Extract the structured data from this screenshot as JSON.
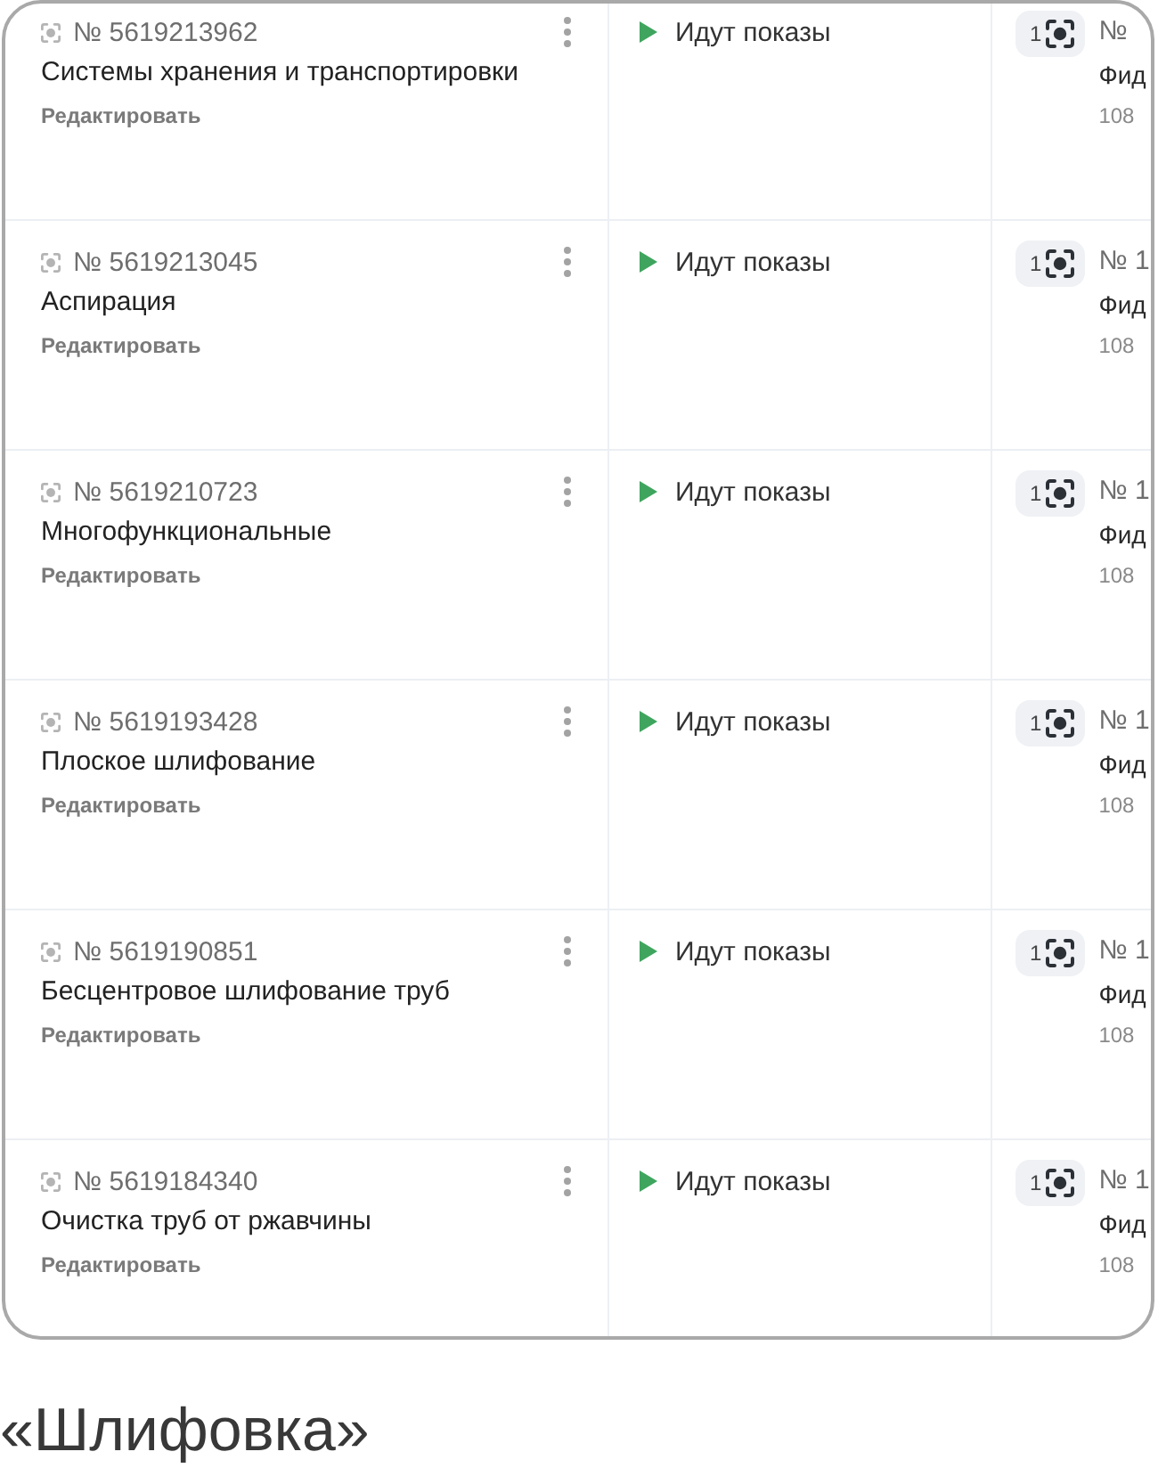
{
  "rows": [
    {
      "number": "№ 5619213962",
      "name": "Системы хранения и транспортировки",
      "edit_link": "Редактировать",
      "status": {
        "kind": "running",
        "label": "Идут показы"
      },
      "column_3": {
        "badge_count": "1",
        "line_1": "№",
        "line_2": "Фид",
        "line_3": "108"
      }
    },
    {
      "number": "№ 5619213045",
      "name": "Аспирация",
      "edit_link": "Редактировать",
      "status": {
        "kind": "running",
        "label": "Идут показы"
      },
      "column_3": {
        "badge_count": "1",
        "line_1": "№ 1",
        "line_2": "Фид",
        "line_3": "108"
      }
    },
    {
      "number": "№ 5619210723",
      "name": "Многофункциональные",
      "edit_link": "Редактировать",
      "status": {
        "kind": "running",
        "label": "Идут показы"
      },
      "column_3": {
        "badge_count": "1",
        "line_1": "№ 1",
        "line_2": "Фид",
        "line_3": "108"
      }
    },
    {
      "number": "№ 5619193428",
      "name": "Плоское шлифование",
      "edit_link": "Редактировать",
      "status": {
        "kind": "running",
        "label": "Идут показы"
      },
      "column_3": {
        "badge_count": "1",
        "line_1": "№ 1",
        "line_2": "Фид",
        "line_3": "108"
      }
    },
    {
      "number": "№ 5619190851",
      "name": "Бесцентровое шлифование труб",
      "edit_link": "Редактировать",
      "status": {
        "kind": "running",
        "label": "Идут показы"
      },
      "column_3": {
        "badge_count": "1",
        "line_1": "№ 1",
        "line_2": "Фид",
        "line_3": "108"
      }
    },
    {
      "number": "№ 5619184340",
      "name": "Очистка труб от ржавчины",
      "edit_link": "Редактировать",
      "status": {
        "kind": "running",
        "label": "Идут показы"
      },
      "column_3": {
        "badge_count": "1",
        "line_1": "№ 1",
        "line_2": "Фид",
        "line_3": "108"
      }
    }
  ],
  "caption": "«Шлифовка»"
}
